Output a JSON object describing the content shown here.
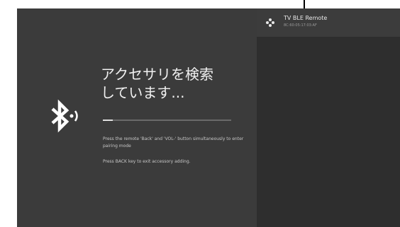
{
  "screen": {
    "title_line1": "アクセサリを検索",
    "title_line2": "しています...",
    "instruction": "Press the remote 'Back' and 'VOL-' button simultaneously to enter pairing mode",
    "exit_hint": "Press BACK key to exit accessory adding.",
    "progress": 0.08
  },
  "devices": [
    {
      "name": "TV BLE Remote",
      "address": "8C:60:05:17:03:AF",
      "icon": "gamepad-icon"
    }
  ],
  "colors": {
    "left_pane": "#3b3b3b",
    "right_pane": "#2e2e2e",
    "device_row": "#3c3c3c",
    "text_primary": "#f0f0f0",
    "text_secondary": "#c8c8c8"
  },
  "icons": {
    "main": "bluetooth-icon"
  }
}
